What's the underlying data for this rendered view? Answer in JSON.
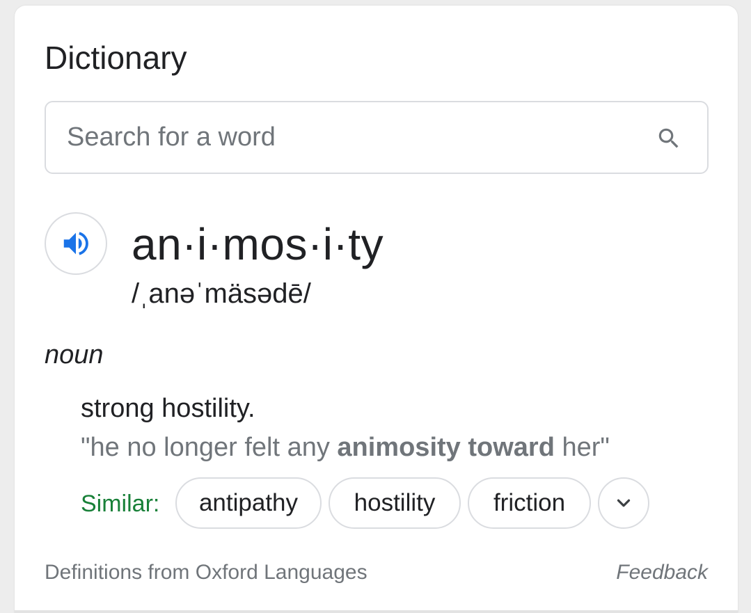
{
  "card": {
    "title": "Dictionary"
  },
  "search": {
    "placeholder": "Search for a word",
    "icon": "search-icon"
  },
  "entry": {
    "speaker_icon": "volume-icon",
    "accent_color": "#1a73e8",
    "headword": "an·i·mos·i·ty",
    "phonetic": "/ˌanəˈmäsədē/",
    "part_of_speech": "noun",
    "definition": "strong hostility.",
    "example": {
      "prefix": "\"he no longer felt any ",
      "bold": "animosity toward",
      "suffix": " her\""
    },
    "similar_label": "Similar:",
    "similar_color": "#188038",
    "similar": [
      "antipathy",
      "hostility",
      "friction"
    ],
    "expand_icon": "chevron-down-icon"
  },
  "footer": {
    "source": "Definitions from Oxford Languages",
    "feedback": "Feedback"
  }
}
